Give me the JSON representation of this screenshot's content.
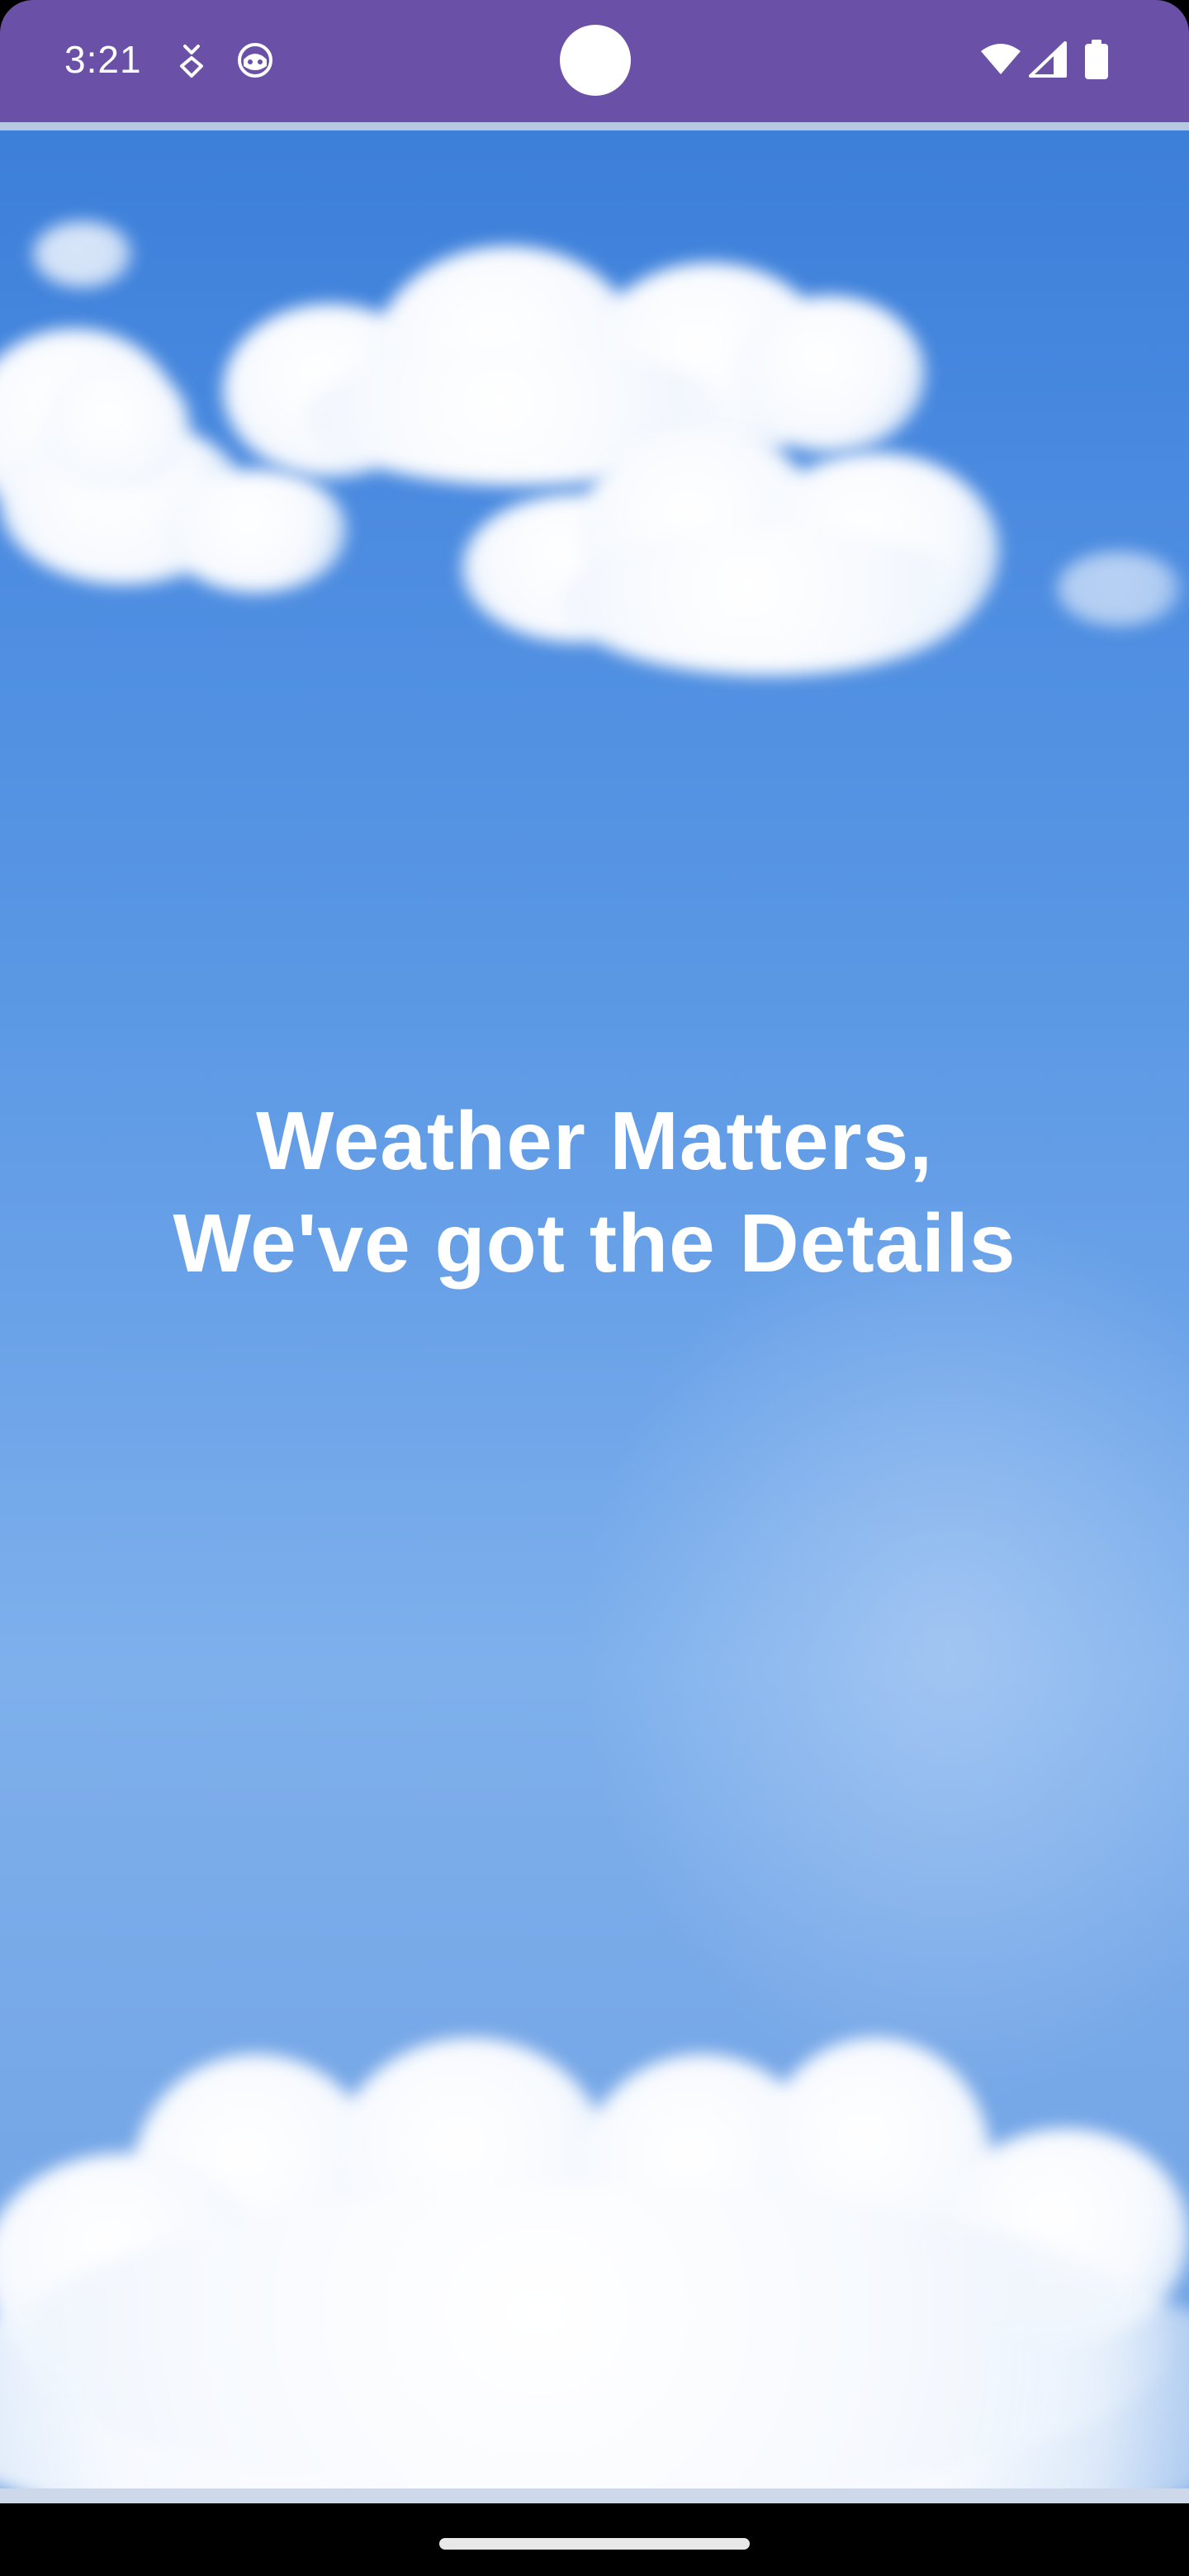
{
  "status_bar": {
    "time": "3:21",
    "background": "#6a50a7",
    "icons": [
      "download-notification-icon",
      "app-notification-icon",
      "wifi-icon",
      "cell-signal-icon",
      "battery-icon"
    ]
  },
  "hero": {
    "line1": "Weather Matters,",
    "line2": "We've got the Details",
    "background_image": "blue-sky-with-clouds",
    "text_color": "#ffffff"
  },
  "navigation_bar": {
    "handle": "home-gesture-handle"
  }
}
